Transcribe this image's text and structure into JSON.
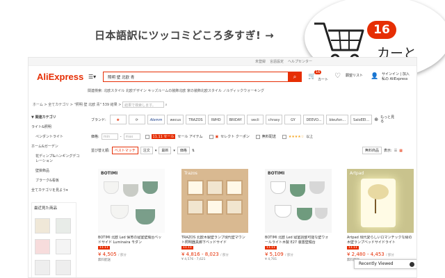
{
  "caption": "日本語訳にツッコミどころ多すぎ! →",
  "cart_callout": {
    "count": "16",
    "label": "カーと"
  },
  "topbar": {
    "items": [
      "未登録",
      "言語設定",
      "ヘルプセンター"
    ]
  },
  "header": {
    "logo": "AliExpress",
    "search_query": "照明 壁 北欧 青",
    "cart_count": "16",
    "cart_label": "カート",
    "wishlist_label": "願望リスト",
    "signin_line1": "サインイン | 加入",
    "signin_line2": "私の AliExpress"
  },
  "hot_searches": "関連検索: 北欧スタイル 北欧デザイン キッズルームの装飾北欧 家の装飾北欧スタイル ノルディックウォーキング",
  "breadcrumb": {
    "text": "ホーム > 全てカテゴリ > \"照明 壁 北欧 青\" 539 結果 >",
    "search_placeholder": "結果で検索します。"
  },
  "left_panel": {
    "items": [
      "▼ 関連カテゴリ",
      "ライト&照明",
      "ペンダントライト",
      "ホーム&ガーデン",
      "花ディンプ&ハンギングデコレーション",
      "壁掛飾品",
      "ブラーク&看板",
      "全てカテゴリを見よう▾"
    ],
    "recent_title": "最近見た商品"
  },
  "brands": {
    "label": "ブランド:",
    "items": [
      "",
      "",
      "",
      "wecus",
      "TRAZOS",
      "IWHD",
      "BRIDAY",
      "vecli",
      "chrasy",
      "GY",
      "DEEVO...",
      "bleufon...",
      "SaloEEI..."
    ],
    "more": "もっと見る"
  },
  "filters": {
    "price_label": "価格:",
    "min": "min",
    "max": "max",
    "sale_badge": "11.11 セール",
    "sale_text": "セール アイテム",
    "coupon": "セレクト クーポン",
    "free_ship": "無料配送",
    "rating": "以上"
  },
  "sort": {
    "label": "並び替え順:",
    "active": "ベストマッチ",
    "options": [
      "注文",
      "最新",
      "価格"
    ],
    "ship_label": "無料商品",
    "view_label": "表示:"
  },
  "products": [
    {
      "brand": "BOTIMI",
      "title": "BOTIMI 北欧 Led 保育の寝室壁燭台ベッドサイド Luminaira モダン",
      "price": "¥ 4,505",
      "unit": "/ 部分",
      "tag": "11.11",
      "sub": "無料配送",
      "colors": [
        "#f4f4f2",
        "#7a9e8a",
        "#c9ccc6"
      ]
    },
    {
      "brand": "Trazos",
      "title": "TRAZOS 北欧木製壁ランプ現代壁マウント照明器具廊下ベッドサイド",
      "price": "¥ 4,816 - 8,023",
      "unit": "/ 部分",
      "tag": "11.11",
      "sub": "¥ 4,576 - 7,621",
      "colors": [
        "#f1e5cf",
        "#caa77d",
        "#fff8e8"
      ]
    },
    {
      "brand": "BOTIMI",
      "title": "BOTIMI 北欧 Led 寝室調整可能な壁ウォールライト木製 E27 装置壁燭台",
      "price": "¥ 5,109",
      "unit": "/ 部分",
      "tag": "11.11",
      "sub": "¥ 4,701",
      "colors": [
        "#f2f2f2",
        "#6f9b7e",
        "#d7d7d7"
      ]
    },
    {
      "brand": "Artpad",
      "title": "Artpad 現代愛らしいロマンチックな緑の木壁ランプベッドサイドライト",
      "price": "¥ 2,480 - 4,453",
      "unit": "/ 部分",
      "tag": "11.11",
      "sub": "無料配送",
      "colors": [
        "#c9c38d",
        "#e8d9a2",
        "#fffbe5"
      ]
    }
  ],
  "recently_viewed": "Recently Viewed",
  "colors": {
    "accent": "#e62e04",
    "brand_orange": "#f39800"
  }
}
